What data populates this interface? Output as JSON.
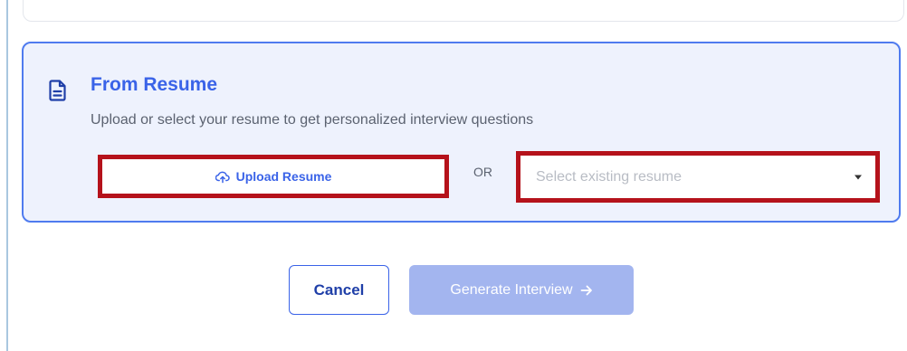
{
  "from_resume": {
    "title": "From Resume",
    "description": "Upload or select your resume to get personalized interview questions",
    "icon": "document-icon",
    "upload_button": {
      "label": "Upload Resume",
      "icon": "cloud-upload-icon"
    },
    "or_label": "OR",
    "resume_select": {
      "placeholder": "Select existing resume",
      "icon": "caret-down-icon"
    }
  },
  "actions": {
    "cancel_label": "Cancel",
    "generate_label": "Generate Interview",
    "generate_icon": "arrow-right-icon",
    "generate_disabled": true
  },
  "colors": {
    "accent": "#3a63e8",
    "card_background": "#eef2fd",
    "highlight_border": "#b5121b",
    "disabled_button": "#a3b5ef"
  }
}
